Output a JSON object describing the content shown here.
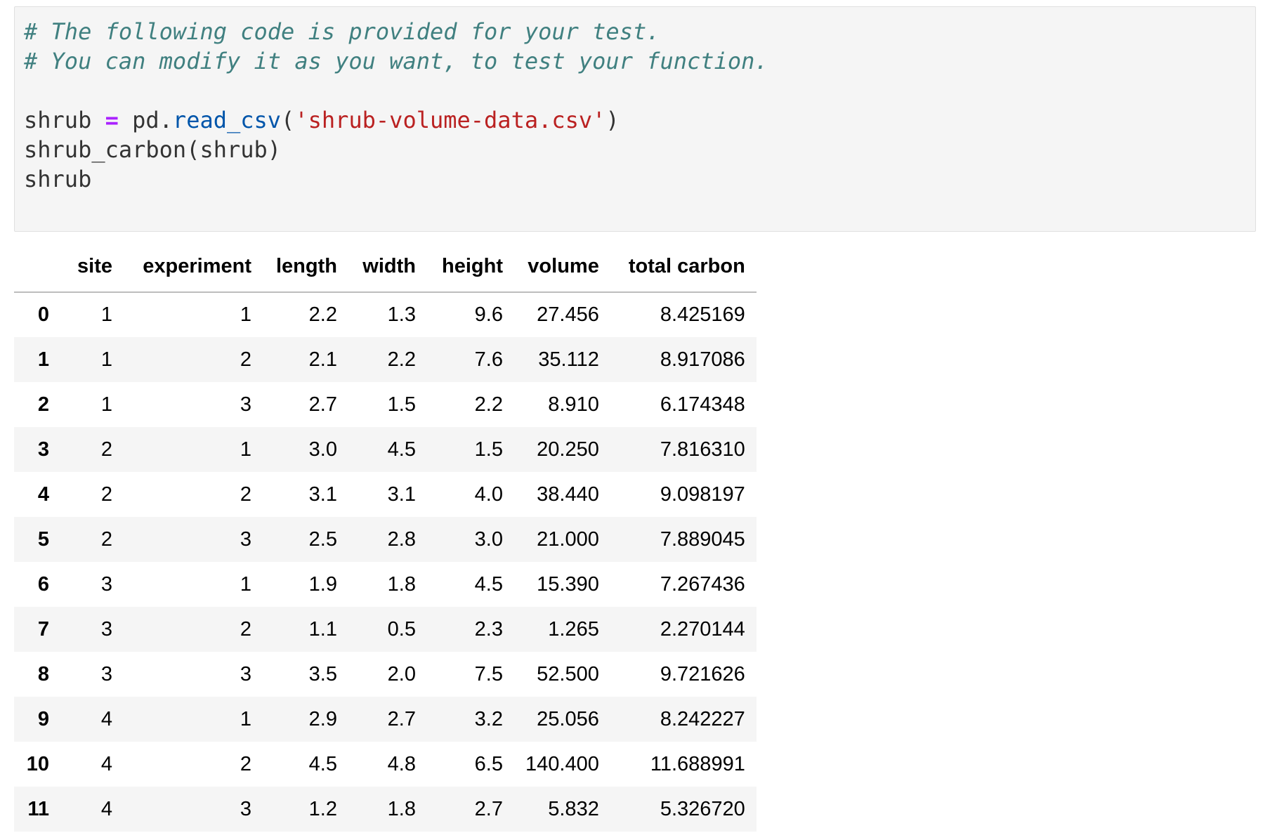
{
  "code_cell": {
    "comment_line_1": "# The following code is provided for your test.",
    "comment_line_2": "# You can modify it as you want, to test your function.",
    "line_3_var": "shrub ",
    "line_3_op": "=",
    "line_3_obj": " pd.",
    "line_3_func": "read_csv",
    "line_3_open": "(",
    "line_3_str": "'shrub-volume-data.csv'",
    "line_3_close": ")",
    "line_4": "shrub_carbon(shrub)",
    "line_5": "shrub"
  },
  "dataframe": {
    "columns": [
      "",
      "site",
      "experiment",
      "length",
      "width",
      "height",
      "volume",
      "total carbon"
    ],
    "rows": [
      {
        "index": "0",
        "site": "1",
        "experiment": "1",
        "length": "2.2",
        "width": "1.3",
        "height": "9.6",
        "volume": "27.456",
        "total_carbon": "8.425169"
      },
      {
        "index": "1",
        "site": "1",
        "experiment": "2",
        "length": "2.1",
        "width": "2.2",
        "height": "7.6",
        "volume": "35.112",
        "total_carbon": "8.917086"
      },
      {
        "index": "2",
        "site": "1",
        "experiment": "3",
        "length": "2.7",
        "width": "1.5",
        "height": "2.2",
        "volume": "8.910",
        "total_carbon": "6.174348"
      },
      {
        "index": "3",
        "site": "2",
        "experiment": "1",
        "length": "3.0",
        "width": "4.5",
        "height": "1.5",
        "volume": "20.250",
        "total_carbon": "7.816310"
      },
      {
        "index": "4",
        "site": "2",
        "experiment": "2",
        "length": "3.1",
        "width": "3.1",
        "height": "4.0",
        "volume": "38.440",
        "total_carbon": "9.098197"
      },
      {
        "index": "5",
        "site": "2",
        "experiment": "3",
        "length": "2.5",
        "width": "2.8",
        "height": "3.0",
        "volume": "21.000",
        "total_carbon": "7.889045"
      },
      {
        "index": "6",
        "site": "3",
        "experiment": "1",
        "length": "1.9",
        "width": "1.8",
        "height": "4.5",
        "volume": "15.390",
        "total_carbon": "7.267436"
      },
      {
        "index": "7",
        "site": "3",
        "experiment": "2",
        "length": "1.1",
        "width": "0.5",
        "height": "2.3",
        "volume": "1.265",
        "total_carbon": "2.270144"
      },
      {
        "index": "8",
        "site": "3",
        "experiment": "3",
        "length": "3.5",
        "width": "2.0",
        "height": "7.5",
        "volume": "52.500",
        "total_carbon": "9.721626"
      },
      {
        "index": "9",
        "site": "4",
        "experiment": "1",
        "length": "2.9",
        "width": "2.7",
        "height": "3.2",
        "volume": "25.056",
        "total_carbon": "8.242227"
      },
      {
        "index": "10",
        "site": "4",
        "experiment": "2",
        "length": "4.5",
        "width": "4.8",
        "height": "6.5",
        "volume": "140.400",
        "total_carbon": "11.688991"
      },
      {
        "index": "11",
        "site": "4",
        "experiment": "3",
        "length": "1.2",
        "width": "1.8",
        "height": "2.7",
        "volume": "5.832",
        "total_carbon": "5.326720"
      }
    ]
  },
  "colors": {
    "cell_background": "#f5f5f5",
    "comment": "#408080",
    "operator": "#aa22ff",
    "attribute": "#0055aa",
    "string": "#ba2121"
  }
}
